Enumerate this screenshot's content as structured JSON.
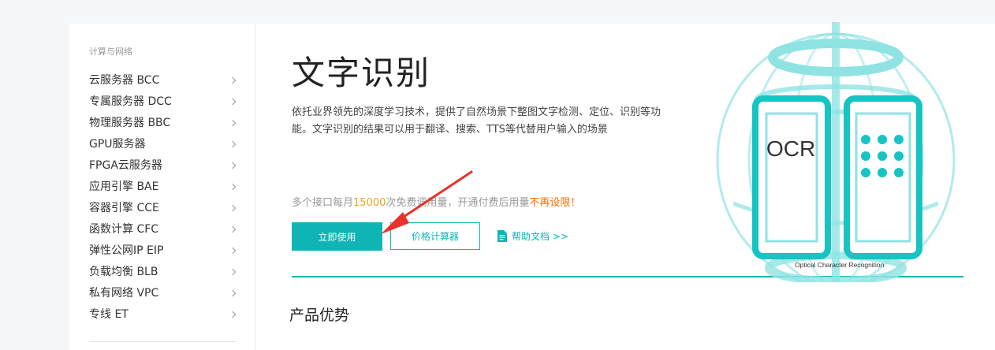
{
  "sidebar": {
    "heading": "计算与网络",
    "items": [
      {
        "label": "云服务器 BCC"
      },
      {
        "label": "专属服务器 DCC"
      },
      {
        "label": "物理服务器 BBC"
      },
      {
        "label": "GPU服务器"
      },
      {
        "label": "FPGA云服务器"
      },
      {
        "label": "应用引擎 BAE"
      },
      {
        "label": "容器引擎 CCE"
      },
      {
        "label": "函数计算 CFC"
      },
      {
        "label": "弹性公网IP EIP"
      },
      {
        "label": "负载均衡 BLB"
      },
      {
        "label": "私有网络 VPC"
      },
      {
        "label": "专线 ET"
      }
    ]
  },
  "product": {
    "title": "文字识别",
    "description": "依托业界领先的深度学习技术，提供了自然场景下整图文字检测、定位、识别等功能。文字识别的结果可以用于翻译、搜索、TTS等代替用户输入的场景",
    "quota_prefix": "多个接口每月",
    "quota_number": "15000",
    "quota_middle": "次免费调用量，开通付费后用量",
    "quota_highlight": "不再设限！",
    "use_button": "立即使用",
    "price_button": "价格计算器",
    "doc_link": "帮助文档 >>",
    "section_title": "产品优势"
  },
  "illustration": {
    "ocr_label": "OCR",
    "caption": "Optical Character Recognition"
  },
  "colors": {
    "accent": "#0fb5b5",
    "art_light": "#8fe3e3",
    "quota_number": "#f0a21b",
    "quota_highlight": "#ff6a00",
    "annotation_arrow": "#e8322b"
  }
}
